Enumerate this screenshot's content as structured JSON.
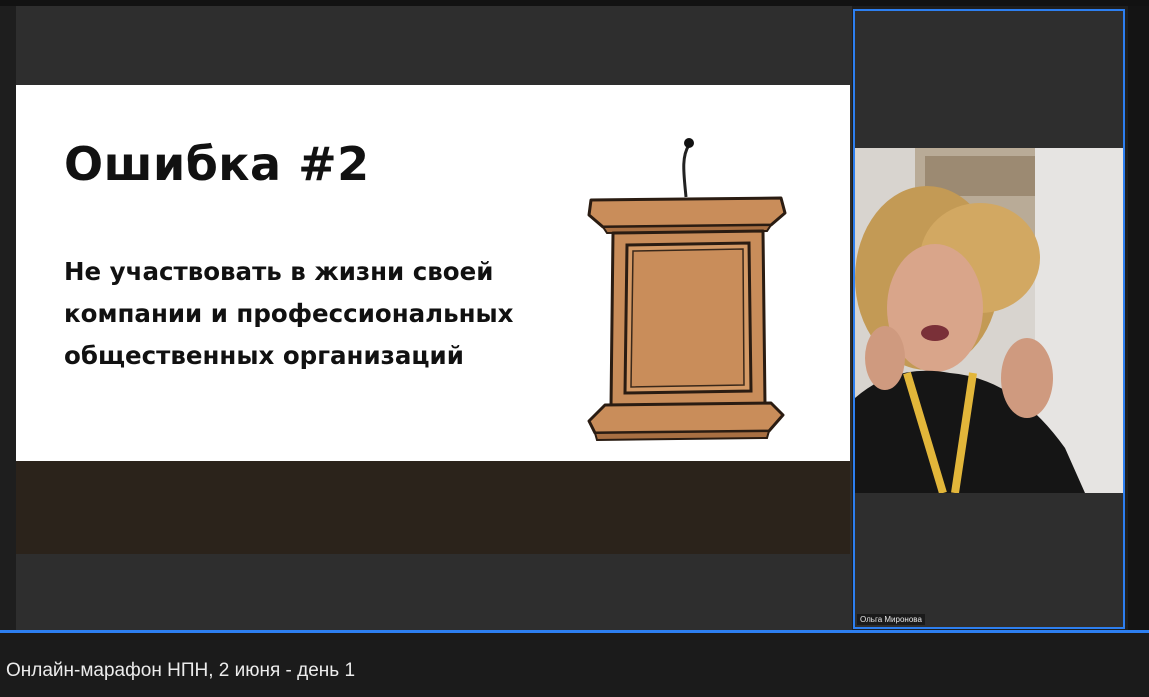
{
  "slide": {
    "title": "Ошибка #2",
    "body_lines": [
      "Не участвовать в жизни своей",
      "компании и профессиональных",
      "общественных организаций"
    ]
  },
  "participant": {
    "name": "Ольга Миронова"
  },
  "video": {
    "title": "Онлайн-марафон НПН, 2 июня - день 1"
  },
  "colors": {
    "accent": "#2d7ff0",
    "podium": "#c98d5a",
    "slide_bottom": "#2b231b"
  },
  "icons": [
    "podium-illustration",
    "microphone-icon"
  ]
}
